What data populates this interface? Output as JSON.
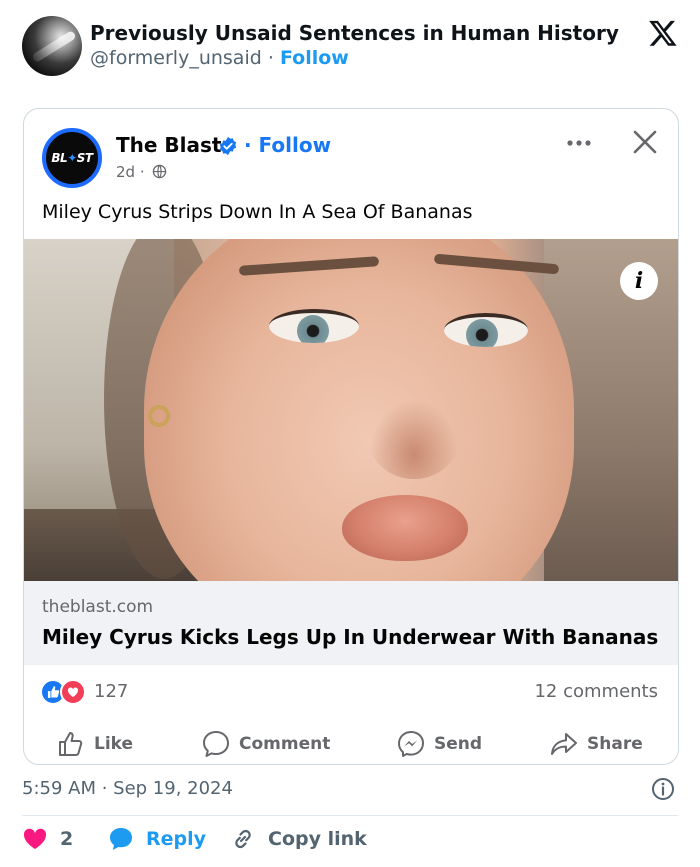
{
  "tweet": {
    "author_name": "Previously Unsaid Sentences in Human History",
    "handle": "@formerly_unsaid",
    "separator": "·",
    "follow_label": "Follow",
    "timestamp": "5:59 AM · Sep 19, 2024",
    "likes_count": "2",
    "reply_label": "Reply",
    "copy_link_label": "Copy link",
    "colors": {
      "follow": "#1d9bf0",
      "like_heart": "#f91880",
      "reply_bubble": "#1d9bf0"
    }
  },
  "embedded_post": {
    "page_name": "The Blast",
    "follow_label": "· Follow",
    "age": "2d ·",
    "logo_text_a": "BL",
    "logo_text_b": "ST",
    "post_text": "Miley Cyrus Strips Down In A Sea Of Bananas",
    "info_glyph": "i",
    "link_domain": "theblast.com",
    "link_title": "Miley Cyrus Kicks Legs Up In Underwear With Bananas",
    "reactions_count": "127",
    "comments_count": "12 comments",
    "actions": {
      "like": "Like",
      "comment": "Comment",
      "send": "Send",
      "share": "Share"
    },
    "colors": {
      "follow": "#1877f2",
      "like": "#1877f2",
      "love": "#f33e58"
    }
  }
}
